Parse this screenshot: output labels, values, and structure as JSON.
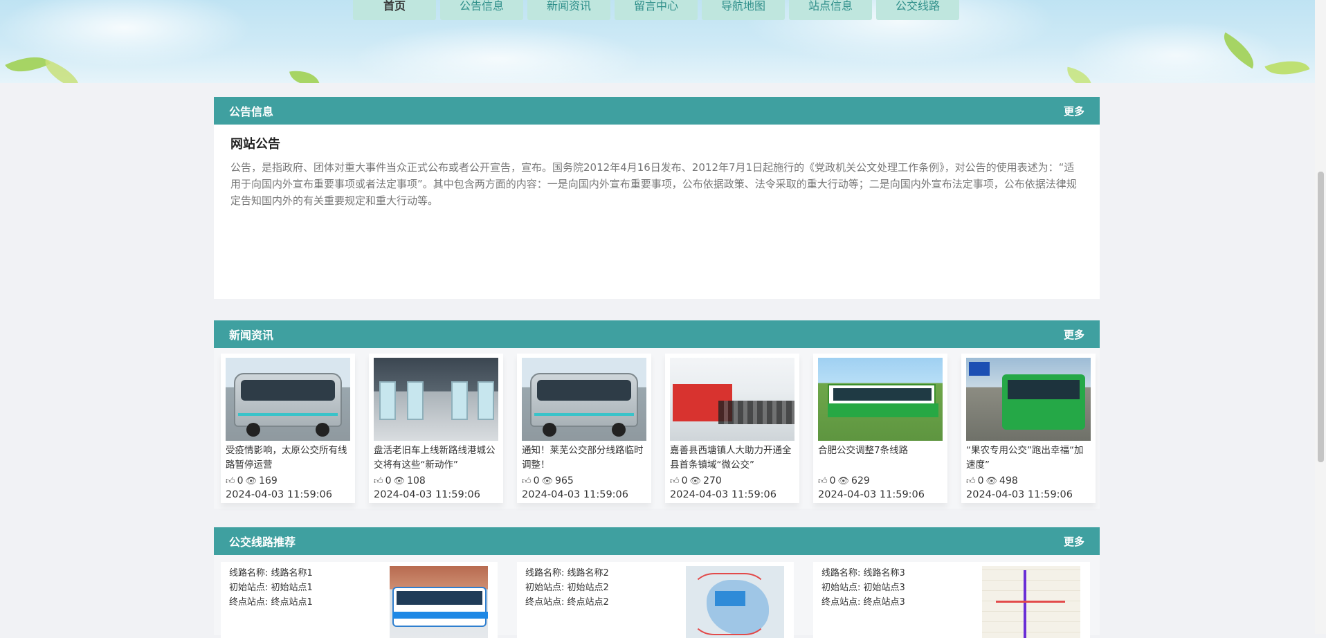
{
  "nav": {
    "tabs": [
      {
        "label": "首页",
        "active": true
      },
      {
        "label": "公告信息"
      },
      {
        "label": "新闻资讯"
      },
      {
        "label": "留言中心"
      },
      {
        "label": "导航地图"
      },
      {
        "label": "站点信息"
      },
      {
        "label": "公交线路"
      }
    ]
  },
  "notice": {
    "header": "公告信息",
    "more": "更多",
    "title": "网站公告",
    "text": "公告，是指政府、团体对重大事件当众正式公布或者公开宣告，宣布。国务院2012年4月16日发布、2012年7月1日起施行的《党政机关公文处理工作条例》，对公告的使用表述为：“适用于向国内外宣布重要事项或者法定事项”。其中包含两方面的内容：一是向国内外宣布重要事项，公布依据政策、法令采取的重大行动等；二是向国内外宣布法定事项，公布依据法律规定告知国内外的有关重要规定和重大行动等。"
  },
  "news": {
    "header": "新闻资讯",
    "more": "更多",
    "items": [
      {
        "title": "受疫情影响，太原公交所有线路暂停运营",
        "likes": "0",
        "views": "169",
        "date": "2024-04-03 11:59:06"
      },
      {
        "title": "盘活老旧车上线新路线港城公交将有这些“新动作”",
        "likes": "0",
        "views": "108",
        "date": "2024-04-03 11:59:06"
      },
      {
        "title": "通知！莱芜公交部分线路临时调整！",
        "likes": "0",
        "views": "965",
        "date": "2024-04-03 11:59:06"
      },
      {
        "title": "嘉善县西塘镇人大助力开通全县首条镇域“微公交”",
        "likes": "0",
        "views": "270",
        "date": "2024-04-03 11:59:06"
      },
      {
        "title": "合肥公交调整7条线路",
        "likes": "0",
        "views": "629",
        "date": "2024-04-03 11:59:06"
      },
      {
        "title": "“果农专用公交”跑出幸福“加速度”",
        "likes": "0",
        "views": "498",
        "date": "2024-04-03 11:59:06"
      }
    ]
  },
  "routes": {
    "header": "公交线路推荐",
    "more": "更多",
    "items": [
      {
        "name": "线路名称: 线路名称1",
        "start": "初始站点: 初始站点1",
        "end": "终点站点: 终点站点1"
      },
      {
        "name": "线路名称: 线路名称2",
        "start": "初始站点: 初始站点2",
        "end": "终点站点: 终点站点2"
      },
      {
        "name": "线路名称: 线路名称3",
        "start": "初始站点: 初始站点3",
        "end": "终点站点: 终点站点3"
      }
    ]
  },
  "icons": {
    "like": "thumbs-up-icon",
    "view": "eye-icon"
  },
  "colors": {
    "accent": "#3fa0a0",
    "nav_tab": "#bfe6de",
    "nav_text": "#2f8f8a"
  }
}
